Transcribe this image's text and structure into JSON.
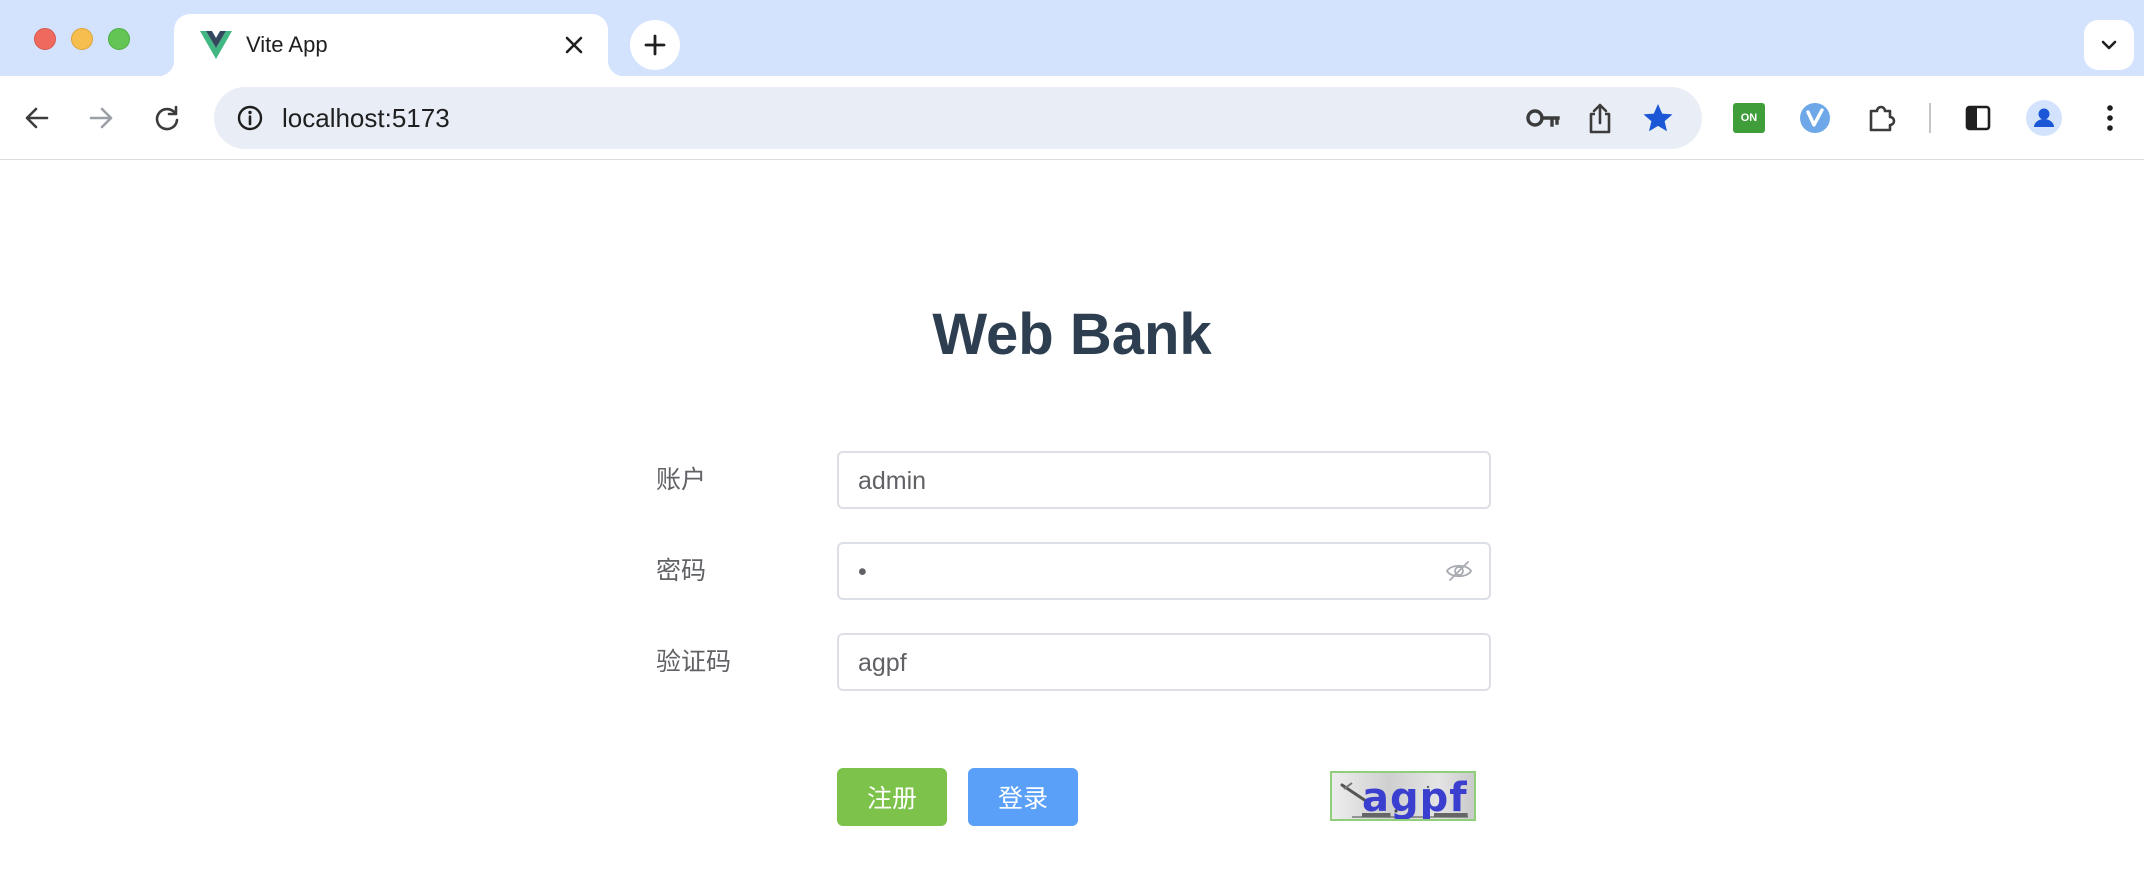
{
  "browser": {
    "tab": {
      "title": "Vite App",
      "favicon": "vue-logo-icon"
    },
    "address": {
      "url": "localhost:5173"
    },
    "icons": [
      "info-icon",
      "password-key-icon",
      "share-icon",
      "bookmark-star-icon",
      "extension-on-icon",
      "extension-v-icon",
      "puzzle-extensions-icon",
      "side-panel-icon",
      "profile-avatar-icon",
      "menu-kebab-icon"
    ],
    "extension_on_label": "ON"
  },
  "page": {
    "title": "Web Bank",
    "form": {
      "account_label": "账户",
      "account_value": "admin",
      "password_label": "密码",
      "password_value": "•",
      "captcha_label": "验证码",
      "captcha_value": "agpf"
    },
    "buttons": {
      "register": "注册",
      "login": "登录"
    },
    "captcha_image_text": "agpf"
  },
  "colors": {
    "register_button": "#7dc24b",
    "login_button": "#5aa0f8",
    "title": "#2c3e50",
    "tabstrip": "#d3e3fd",
    "bookmark_star": "#1a56d6"
  }
}
